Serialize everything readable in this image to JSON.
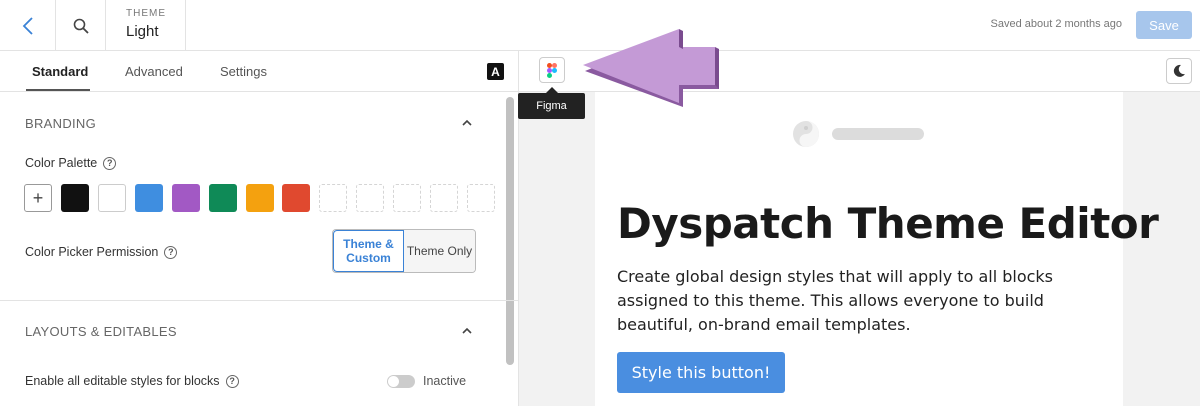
{
  "topbar": {
    "theme_label": "THEME",
    "theme_value": "Light",
    "saved_text": "Saved about 2 months ago",
    "save_label": "Save",
    "back_icon": "chevron-left-icon",
    "search_icon": "search-icon"
  },
  "left": {
    "tabs": [
      {
        "label": "Standard",
        "active": true
      },
      {
        "label": "Advanced",
        "active": false
      },
      {
        "label": "Settings",
        "active": false
      }
    ],
    "font_toggle": "A",
    "branding": {
      "title": "BRANDING",
      "palette_label": "Color Palette",
      "palette": [
        "#111111",
        "#ffffff",
        "#3f8ee0",
        "#a259c4",
        "#0f8a57",
        "#f4a10f",
        "#e0492f",
        "",
        "",
        "",
        "",
        ""
      ],
      "picker_label": "Color Picker Permission",
      "picker_options": [
        "Theme & Custom",
        "Theme Only"
      ],
      "picker_selected": "Theme & Custom"
    },
    "layouts": {
      "title": "LAYOUTS & EDITABLES",
      "editable_label": "Enable all editable styles for blocks",
      "toggle_state": "Inactive"
    }
  },
  "preview": {
    "tooltip": "Figma",
    "email": {
      "title": "Dyspatch Theme Editor",
      "body": "Create global design styles that will apply to all blocks assigned to this theme. This allows everyone to build beautiful, on-brand email templates.",
      "button": "Style this button!"
    }
  },
  "colors": {
    "accent": "#3a82d6",
    "save_disabled": "#a7c6ec",
    "email_button": "#4a8ee0",
    "pointer_arrow": "#c49ad6"
  }
}
